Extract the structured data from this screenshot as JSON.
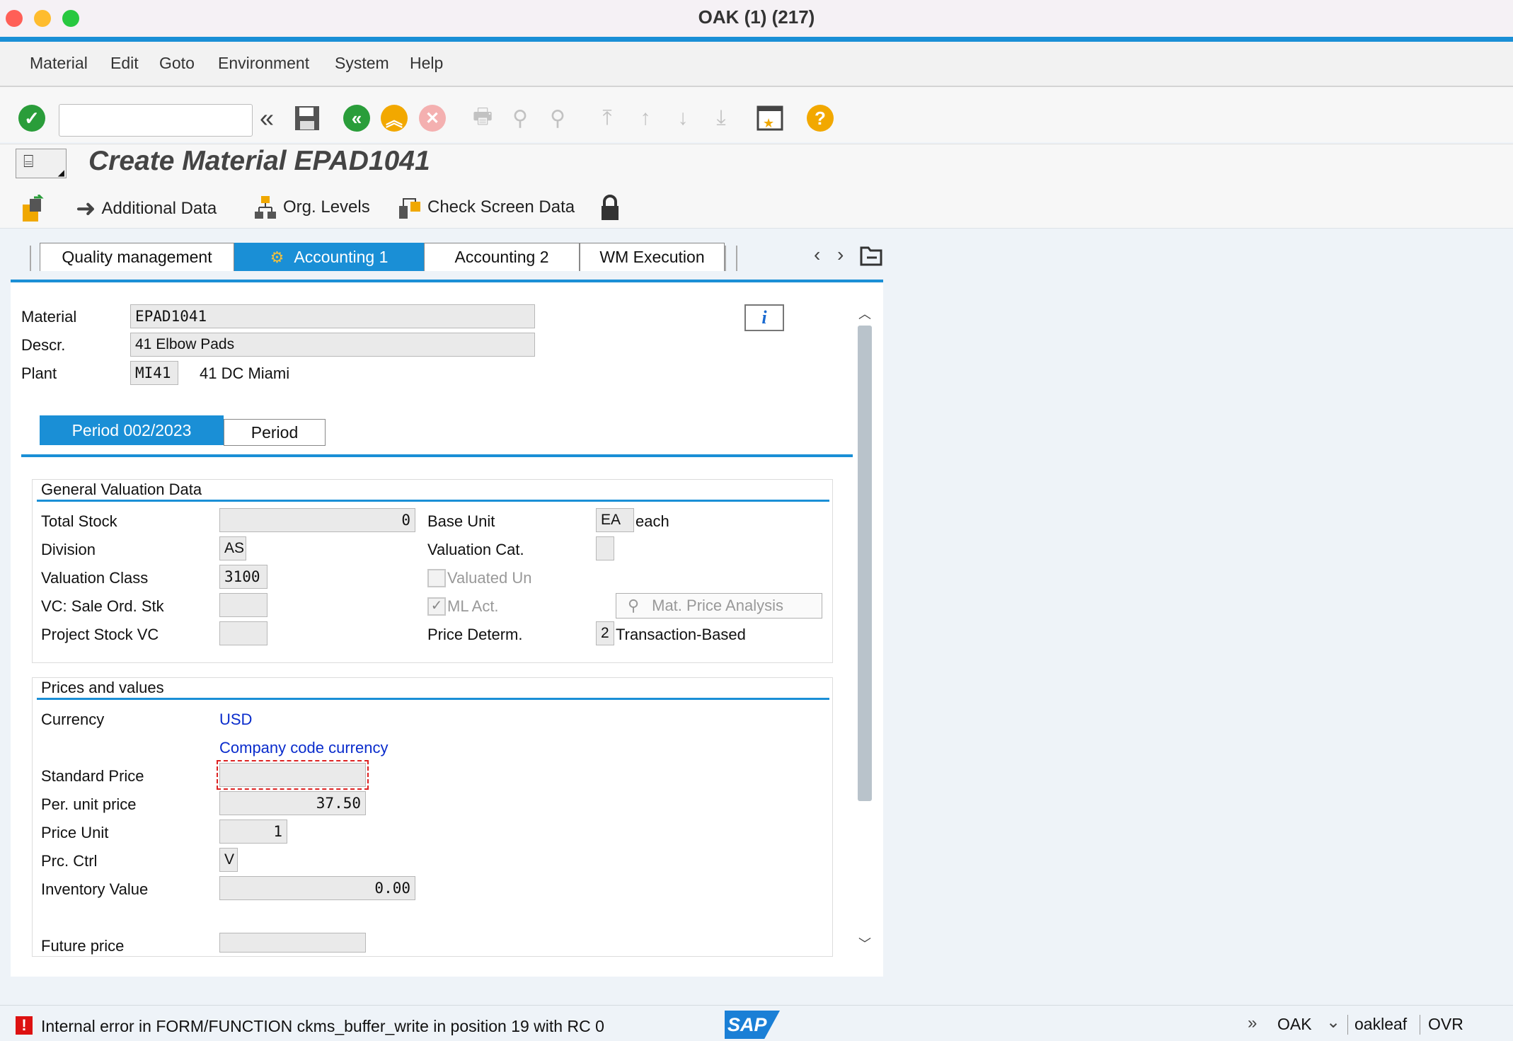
{
  "window": {
    "title": "OAK (1) (217)"
  },
  "menu": [
    "Material",
    "Edit",
    "Goto",
    "Environment",
    "System",
    "Help"
  ],
  "toolbar": {
    "command_placeholder": "",
    "icons": [
      "enter-icon",
      "history-icon",
      "save-icon",
      "back-icon",
      "exit-icon",
      "cancel-icon",
      "print-icon",
      "find-icon",
      "find-next-icon",
      "first-page-icon",
      "previous-page-icon",
      "next-page-icon",
      "last-page-icon",
      "bookmark-icon",
      "help-icon"
    ]
  },
  "header": {
    "title": "Create Material EPAD1041"
  },
  "app_toolbar": {
    "additional_data": "Additional Data",
    "org_levels": "Org. Levels",
    "check_screen": "Check Screen Data"
  },
  "tabs": [
    "Quality management",
    "Accounting 1",
    "Accounting 2",
    "WM Execution"
  ],
  "material": {
    "material_label": "Material",
    "material_value": "EPAD1041",
    "descr_label": "Descr.",
    "descr_value": "41 Elbow Pads",
    "plant_label": "Plant",
    "plant_value": "MI41",
    "plant_name": "41 DC Miami"
  },
  "subtabs": [
    "Period 002/2023",
    "Period"
  ],
  "general": {
    "title": "General Valuation Data",
    "total_stock_label": "Total Stock",
    "total_stock_value": "0",
    "base_unit_label": "Base Unit",
    "base_unit_value": "EA",
    "base_unit_text": "each",
    "division_label": "Division",
    "division_value": "AS",
    "valuation_cat_label": "Valuation Cat.",
    "valuation_cat_value": "",
    "valuation_class_label": "Valuation Class",
    "valuation_class_value": "3100",
    "valuated_un_label": "Valuated Un",
    "vc_sale_label": "VC: Sale Ord. Stk",
    "vc_sale_value": "",
    "ml_act_label": "ML Act.",
    "mat_price_button": "Mat. Price Analysis",
    "project_stock_label": "Project Stock VC",
    "project_stock_value": "",
    "price_determ_label": "Price Determ.",
    "price_determ_value": "2",
    "price_determ_text": "Transaction-Based"
  },
  "prices": {
    "title": "Prices and values",
    "currency_label": "Currency",
    "currency_value": "USD",
    "company_currency": "Company code currency",
    "standard_price_label": "Standard Price",
    "standard_price_value": "",
    "per_unit_label": "Per. unit price",
    "per_unit_value": "37.50",
    "price_unit_label": "Price Unit",
    "price_unit_value": "1",
    "prc_ctrl_label": "Prc. Ctrl",
    "prc_ctrl_value": "V",
    "inventory_label": "Inventory Value",
    "inventory_value": "0.00",
    "future_label": "Future price",
    "future_value": ""
  },
  "status": {
    "message": "Internal error in FORM/FUNCTION ckms_buffer_write in position 19 with RC 0",
    "logo": "SAP",
    "system": "OAK",
    "user": "oakleaf",
    "mode": "OVR"
  }
}
